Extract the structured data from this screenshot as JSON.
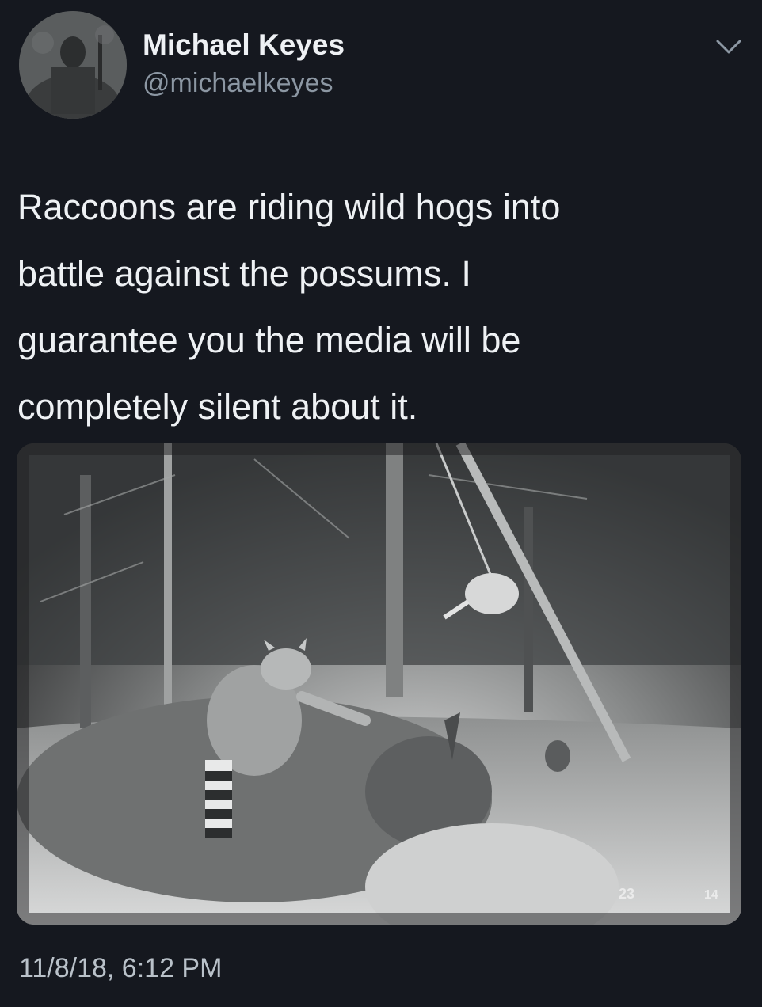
{
  "author": {
    "display_name": "Michael Keyes",
    "handle": "@michaelkeyes"
  },
  "menu": {
    "icon": "chevron-down-icon"
  },
  "tweet": {
    "text": "Raccoons are riding wild hogs into\nbattle against the possums. I\nguarantee you the media will be\ncompletely silent about it.",
    "timestamp": "11/8/18, 6:12 PM"
  },
  "media": {
    "camera_overlay_left": "23",
    "camera_overlay_right": "14"
  },
  "colors": {
    "background": "#15181f",
    "primary_text": "#eef1f4",
    "secondary_text": "#8c97a3"
  }
}
